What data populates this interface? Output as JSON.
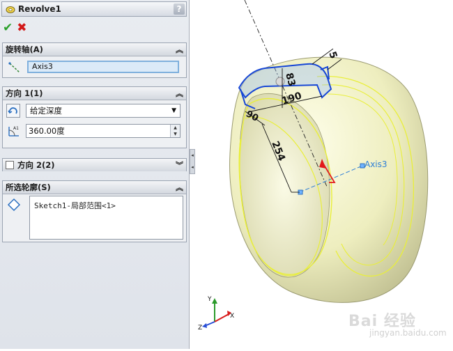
{
  "feature": {
    "title": "Revolve1",
    "help": "?"
  },
  "actions": {
    "ok": "✔",
    "cancel": "✖"
  },
  "rotation_axis": {
    "heading": "旋转轴(A)",
    "value": "Axis3"
  },
  "direction1": {
    "heading": "方向 1(1)",
    "end_condition": "给定深度",
    "angle": "360.00度",
    "spin_label": "A1"
  },
  "direction2": {
    "heading": "方向 2(2)"
  },
  "contours": {
    "heading": "所选轮廓(S)",
    "items": [
      "Sketch1-局部范围<1>"
    ]
  },
  "viewport": {
    "axis_label": "Axis3",
    "dimensions": {
      "d5": "5",
      "d83": "83",
      "d190": "190",
      "d90": "90",
      "d254": "254"
    },
    "triad": {
      "x": "X",
      "y": "Y",
      "z": "Z"
    }
  },
  "watermark": {
    "brand": "Bai 经验",
    "url": "jingyan.baidu.com"
  },
  "colors": {
    "accent": "#3c7fd1",
    "highlight": "#e9ef3a",
    "part": "#f2f1c8"
  }
}
